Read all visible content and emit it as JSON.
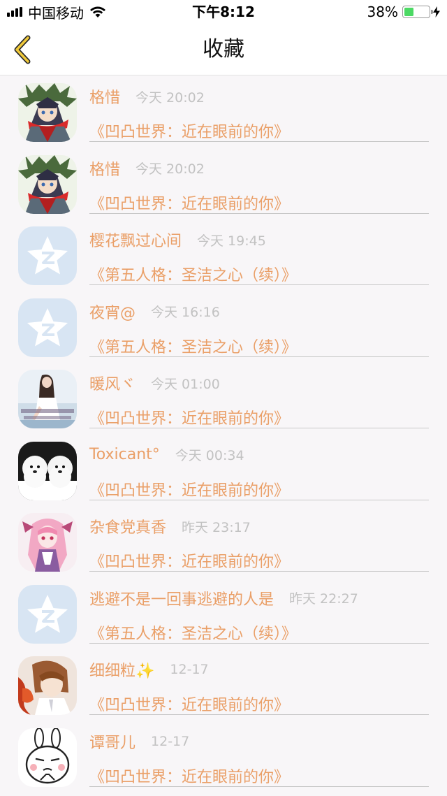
{
  "status_bar": {
    "carrier": "中国移动",
    "time": "下午8:12",
    "battery_percent": "38%",
    "battery_level": 0.38
  },
  "nav": {
    "title": "收藏",
    "back_icon": "chevron-left-icon"
  },
  "colors": {
    "accent": "#ea9f67",
    "time_gray": "#c2c2c2",
    "battery_green": "#4cd964"
  },
  "favorites": [
    {
      "user": "格惜",
      "time": "今天 20:02",
      "title": "《凹凸世界：近在眼前的你》",
      "avatar": "anime-boy"
    },
    {
      "user": "格惜",
      "time": "今天 20:02",
      "title": "《凹凸世界：近在眼前的你》",
      "avatar": "anime-boy"
    },
    {
      "user": "樱花飘过心间",
      "time": "今天 19:45",
      "title": "《第五人格：圣洁之心（续）》",
      "avatar": "qzone-default"
    },
    {
      "user": "夜宵@",
      "time": "今天 16:16",
      "title": "《第五人格：圣洁之心（续）》",
      "avatar": "qzone-default"
    },
    {
      "user": "暖风ヾ",
      "time": "今天 01:00",
      "title": "《凹凸世界：近在眼前的你》",
      "avatar": "girl-photo"
    },
    {
      "user": "Toxicant°",
      "time": "今天 00:34",
      "title": "《凹凸世界：近在眼前的你》",
      "avatar": "white-dogs"
    },
    {
      "user": "杂食党真香",
      "time": "昨天 23:17",
      "title": "《凹凸世界：近在眼前的你》",
      "avatar": "pink-anime-girl"
    },
    {
      "user": "逃避不是一回事逃避的人是",
      "time": "昨天 22:27",
      "title": "《第五人格：圣洁之心（续）》",
      "avatar": "qzone-default"
    },
    {
      "user": "细细粒✨",
      "time": "12-17",
      "title": "《凹凸世界：近在眼前的你》",
      "avatar": "anime-brown-hair"
    },
    {
      "user": "谭哥儿",
      "time": "12-17",
      "title": "《凹凸世界：近在眼前的你》",
      "avatar": "rabbit-cartoon"
    }
  ]
}
